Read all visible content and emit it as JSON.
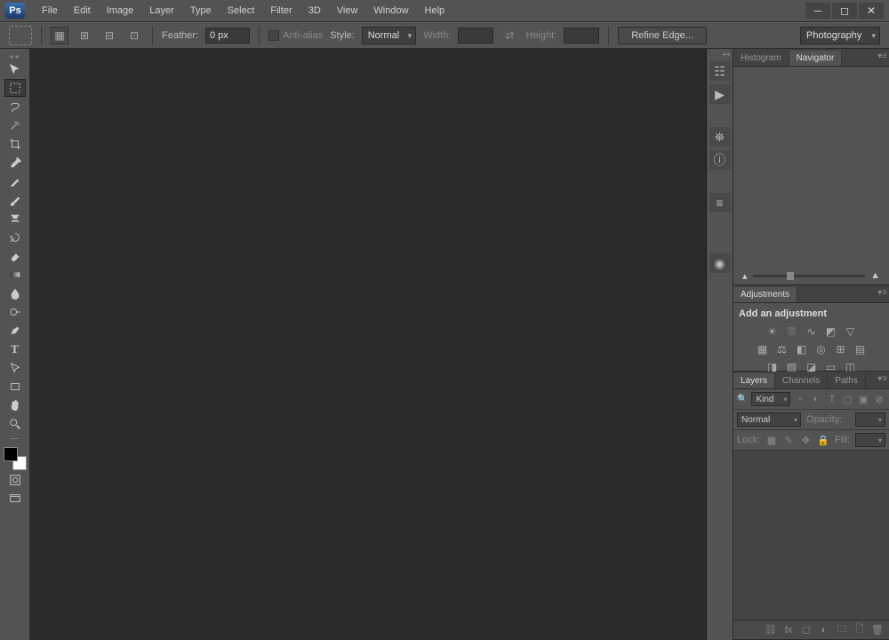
{
  "app": {
    "logo": "Ps"
  },
  "menu": {
    "file": "File",
    "edit": "Edit",
    "image": "Image",
    "layer": "Layer",
    "type": "Type",
    "select": "Select",
    "filter": "Filter",
    "threeD": "3D",
    "view": "View",
    "window": "Window",
    "help": "Help"
  },
  "options": {
    "feather_label": "Feather:",
    "feather_value": "0 px",
    "antialias_label": "Anti-alias",
    "style_label": "Style:",
    "style_value": "Normal",
    "width_label": "Width:",
    "height_label": "Height:",
    "refine_label": "Refine Edge...",
    "workspace": "Photography"
  },
  "panels": {
    "histogram_tab": "Histogram",
    "navigator_tab": "Navigator",
    "adjustments_tab": "Adjustments",
    "adjustments_title": "Add an adjustment",
    "layers_tab": "Layers",
    "channels_tab": "Channels",
    "paths_tab": "Paths"
  },
  "layers": {
    "filter_label": "Kind",
    "blend_mode": "Normal",
    "opacity_label": "Opacity:",
    "lock_label": "Lock:",
    "fill_label": "Fill:"
  }
}
